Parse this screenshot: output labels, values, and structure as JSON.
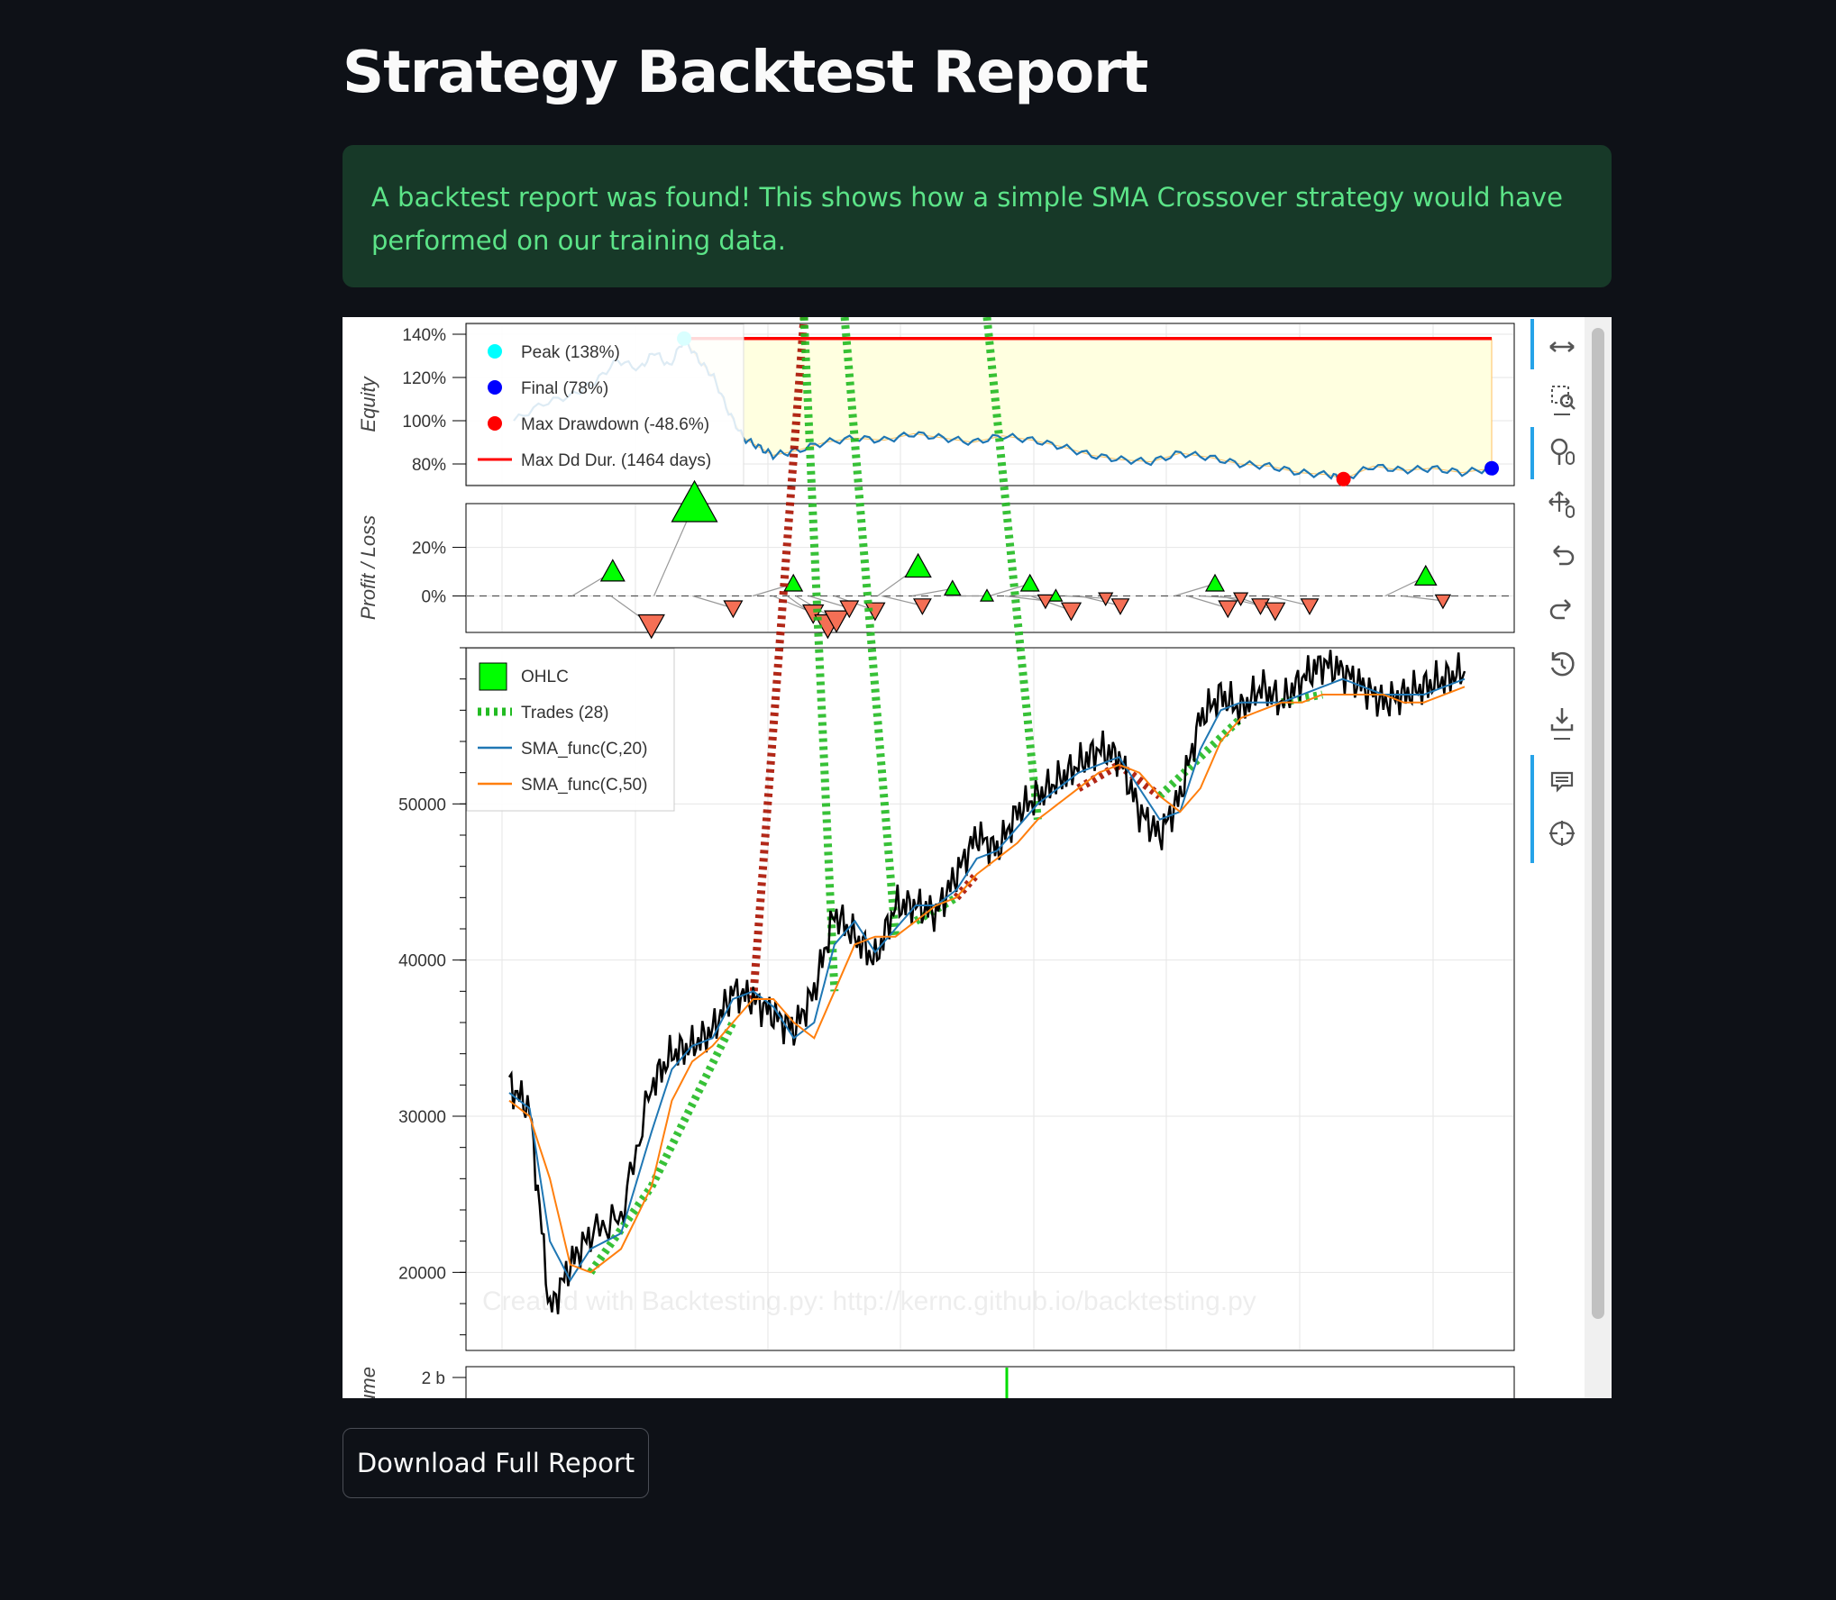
{
  "page": {
    "title": "Strategy Backtest Report",
    "alert_text": "A backtest report was found! This shows how a simple SMA Crossover strategy would have performed on our training data.",
    "download_label": "Download Full Report"
  },
  "colors": {
    "background": "#0e1117",
    "alert_bg": "#173928",
    "alert_text": "#5ce488",
    "equity_line": "#1f77b4",
    "drawdown_fill": "#ffffe0",
    "max_dd_line": "#ff0000",
    "win_marker": "#00ff00",
    "loss_marker": "#f56f55",
    "sma20": "#1f77b4",
    "sma50": "#ff7f0e"
  },
  "toolbar": {
    "icons": [
      "pan-icon",
      "box-zoom-icon",
      "wheel-zoom-icon",
      "wheel-pan-icon",
      "undo-icon",
      "redo-icon",
      "reset-icon",
      "save-icon",
      "hover-icon",
      "crosshair-icon"
    ]
  },
  "chart_data": [
    {
      "type": "line",
      "ylabel": "Equity",
      "ylim": [
        70,
        145
      ],
      "yticks": [
        "80%",
        "100%",
        "120%",
        "140%"
      ],
      "yticks_values": [
        80,
        100,
        120,
        140
      ],
      "grid": true,
      "legend_position": "top-left",
      "legend": [
        "Peak (138%)",
        "Final (78%)",
        "Max Drawdown (-48.6%)",
        "Max Dd Dur. (1464 days)"
      ],
      "peak": {
        "x": 230,
        "y": 138
      },
      "final": {
        "x": 1320,
        "y": 78
      },
      "max_drawdown": {
        "x": 1120,
        "y": 73
      },
      "series": [
        {
          "x": [
            0,
            40,
            80,
            110,
            140,
            170,
            190,
            210,
            230,
            250,
            270,
            290,
            310,
            330,
            350,
            380,
            420,
            460,
            500,
            540,
            580,
            620,
            660,
            700,
            740,
            780,
            820,
            860,
            900,
            940,
            980,
            1020,
            1060,
            1100,
            1120,
            1160,
            1200,
            1240,
            1280,
            1320
          ],
          "y": [
            100,
            108,
            112,
            118,
            128,
            124,
            132,
            125,
            138,
            128,
            120,
            104,
            92,
            88,
            84,
            86,
            90,
            92,
            91,
            94,
            92,
            90,
            93,
            91,
            88,
            84,
            82,
            81,
            85,
            83,
            80,
            79,
            76,
            75,
            73,
            79,
            77,
            78,
            76,
            78
          ]
        }
      ]
    },
    {
      "type": "scatter",
      "ylabel": "Profit / Loss",
      "ylim": [
        -15,
        38
      ],
      "yticks": [
        "0%",
        "20%"
      ],
      "yticks_values": [
        0,
        20
      ],
      "trades": [
        {
          "x": 115,
          "y": 10
        },
        {
          "x": 160,
          "y": -12
        },
        {
          "x": 210,
          "y": 38
        },
        {
          "x": 255,
          "y": -5
        },
        {
          "x": 325,
          "y": 5
        },
        {
          "x": 348,
          "y": -7
        },
        {
          "x": 365,
          "y": -12
        },
        {
          "x": 375,
          "y": -10
        },
        {
          "x": 390,
          "y": -5
        },
        {
          "x": 420,
          "y": -6
        },
        {
          "x": 470,
          "y": 12
        },
        {
          "x": 475,
          "y": -4
        },
        {
          "x": 510,
          "y": 3
        },
        {
          "x": 550,
          "y": 0
        },
        {
          "x": 600,
          "y": 5
        },
        {
          "x": 618,
          "y": -2
        },
        {
          "x": 630,
          "y": 0
        },
        {
          "x": 648,
          "y": -6
        },
        {
          "x": 688,
          "y": -1
        },
        {
          "x": 705,
          "y": -4
        },
        {
          "x": 815,
          "y": 5
        },
        {
          "x": 830,
          "y": -5
        },
        {
          "x": 845,
          "y": -1
        },
        {
          "x": 868,
          "y": -4
        },
        {
          "x": 885,
          "y": -6
        },
        {
          "x": 925,
          "y": -4
        },
        {
          "x": 1060,
          "y": 8
        },
        {
          "x": 1080,
          "y": -2
        }
      ]
    },
    {
      "type": "line",
      "ylim": [
        15000,
        60000
      ],
      "yticks": [
        "20000",
        "30000",
        "40000",
        "50000"
      ],
      "yticks_values": [
        20000,
        30000,
        40000,
        50000
      ],
      "grid": true,
      "legend_position": "top-left",
      "legend": [
        "OHLC",
        "Trades (28)",
        "SMA_func(C,20)",
        "SMA_func(C,50)"
      ],
      "watermark": "Created with Backtesting.py: http://kernc.github.io/backtesting.py",
      "x": [
        0,
        20,
        40,
        60,
        80,
        110,
        140,
        160,
        180,
        200,
        220,
        240,
        260,
        280,
        300,
        320,
        340,
        360,
        380,
        400,
        420,
        440,
        460,
        480,
        500,
        520,
        540,
        560,
        580,
        600,
        620,
        640,
        660,
        680,
        700,
        720,
        740,
        760,
        780,
        800,
        820,
        840,
        860,
        880,
        900,
        920,
        940
      ],
      "series": [
        {
          "name": "OHLC",
          "values": [
            32000,
            30500,
            17500,
            20500,
            22500,
            23500,
            32000,
            34000,
            34500,
            35500,
            38000,
            37500,
            36500,
            35500,
            38000,
            43000,
            41500,
            40000,
            43500,
            43500,
            43000,
            45500,
            48000,
            47000,
            49500,
            50500,
            51500,
            52500,
            53500,
            53000,
            49500,
            48000,
            50500,
            55500,
            57000,
            56000,
            57500,
            56500,
            58000,
            59000,
            58500,
            57500,
            56500,
            57000,
            57500,
            58000,
            58500
          ]
        },
        {
          "name": "SMA_func(C,20)",
          "values": [
            31500,
            30500,
            22000,
            19500,
            21500,
            22500,
            29000,
            33000,
            34500,
            35000,
            37500,
            38000,
            37000,
            35000,
            36000,
            41000,
            42500,
            40500,
            42000,
            43500,
            43500,
            44500,
            46500,
            47000,
            48500,
            50000,
            51000,
            52000,
            52500,
            53000,
            51000,
            49000,
            49500,
            53500,
            56000,
            56500,
            56500,
            56500,
            57000,
            57500,
            58000,
            57500,
            57000,
            57000,
            57000,
            57500,
            58000
          ]
        },
        {
          "name": "SMA_func(C,50)",
          "values": [
            31000,
            30000,
            26000,
            20500,
            20000,
            21500,
            25500,
            31000,
            33500,
            34500,
            36000,
            37500,
            37500,
            36000,
            35000,
            38000,
            41000,
            41500,
            41500,
            42500,
            43500,
            44000,
            45500,
            46500,
            47500,
            49000,
            50000,
            51000,
            52000,
            52500,
            52000,
            50500,
            49500,
            51000,
            54000,
            55500,
            56000,
            56500,
            56500,
            57000,
            57000,
            57000,
            57000,
            56500,
            56500,
            57000,
            57500
          ]
        }
      ]
    },
    {
      "type": "bar",
      "ylabel": "Volume",
      "yticks": [
        "2 b"
      ],
      "yticks_values": [
        2
      ]
    }
  ]
}
